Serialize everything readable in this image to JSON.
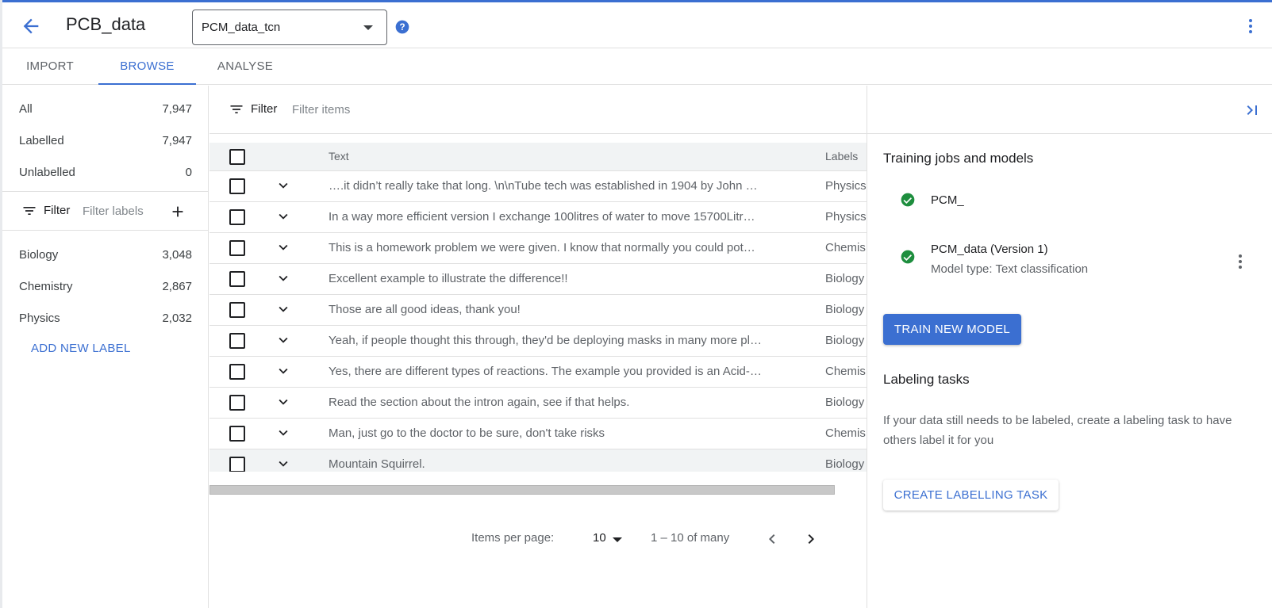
{
  "header": {
    "title": "PCB_data",
    "dataset_select": "PCM_data_tcn"
  },
  "tabs": [
    {
      "label": "IMPORT"
    },
    {
      "label": "BROWSE"
    },
    {
      "label": "ANALYSE"
    }
  ],
  "left_panel": {
    "counts": [
      {
        "label": "All",
        "value": "7,947"
      },
      {
        "label": "Labelled",
        "value": "7,947"
      },
      {
        "label": "Unlabelled",
        "value": "0"
      }
    ],
    "filter_label": "Filter",
    "filter_placeholder": "Filter labels",
    "labels": [
      {
        "label": "Biology",
        "value": "3,048"
      },
      {
        "label": "Chemistry",
        "value": "2,867"
      },
      {
        "label": "Physics",
        "value": "2,032"
      }
    ],
    "add_new_label": "ADD NEW LABEL"
  },
  "main": {
    "filter_label": "Filter",
    "filter_placeholder": "Filter items",
    "columns": {
      "text": "Text",
      "labels": "Labels"
    },
    "rows": [
      {
        "text": "….it didn’t really take that long. \\n\\nTube tech was established in 1904 by John …",
        "label": "Physics"
      },
      {
        "text": "In a way more efficient version I exchange 100litres of water to move 15700Litr…",
        "label": "Physics"
      },
      {
        "text": "This is a homework problem we were given. I know that normally you could pot…",
        "label": "Chemis"
      },
      {
        "text": "Excellent example to illustrate the difference!!",
        "label": "Biology"
      },
      {
        "text": "Those are all good ideas, thank you!",
        "label": "Biology"
      },
      {
        "text": "Yeah, if people thought this through, they'd be deploying masks in many more pl…",
        "label": "Biology"
      },
      {
        "text": "Yes, there are different types of reactions. The example you provided is an Acid-…",
        "label": "Chemis"
      },
      {
        "text": "Read the section about the intron again, see if that helps.",
        "label": "Biology"
      },
      {
        "text": "Man, just go to the doctor to be sure, don't take risks",
        "label": "Chemis"
      },
      {
        "text": "Mountain Squirrel.",
        "label": "Biology"
      }
    ],
    "pagination": {
      "items_per_page_label": "Items per page:",
      "items_per_page": "10",
      "range": "1 – 10 of many"
    }
  },
  "right_panel": {
    "training_title": "Training jobs and models",
    "models": [
      {
        "name": "PCM_",
        "type": ""
      },
      {
        "name": "PCM_data (Version 1)",
        "type": "Model type: Text classification"
      }
    ],
    "train_button": "TRAIN NEW MODEL",
    "labeling_title": "Labeling tasks",
    "labeling_desc": "If your data still needs to be labeled, create a labeling task to have others label it for you",
    "create_button": "CREATE LABELLING TASK"
  },
  "colors": {
    "accent": "#3b6fd1",
    "success": "#1e8e3e"
  },
  "icons": [
    "arrow-back-icon",
    "dropdown-caret-icon",
    "help-icon",
    "more-vert-icon",
    "filter-list-icon",
    "add-icon",
    "checkbox-icon",
    "chevron-down-icon",
    "chevron-left-icon",
    "chevron-right-icon",
    "collapse-panel-icon",
    "check-circle-icon"
  ]
}
